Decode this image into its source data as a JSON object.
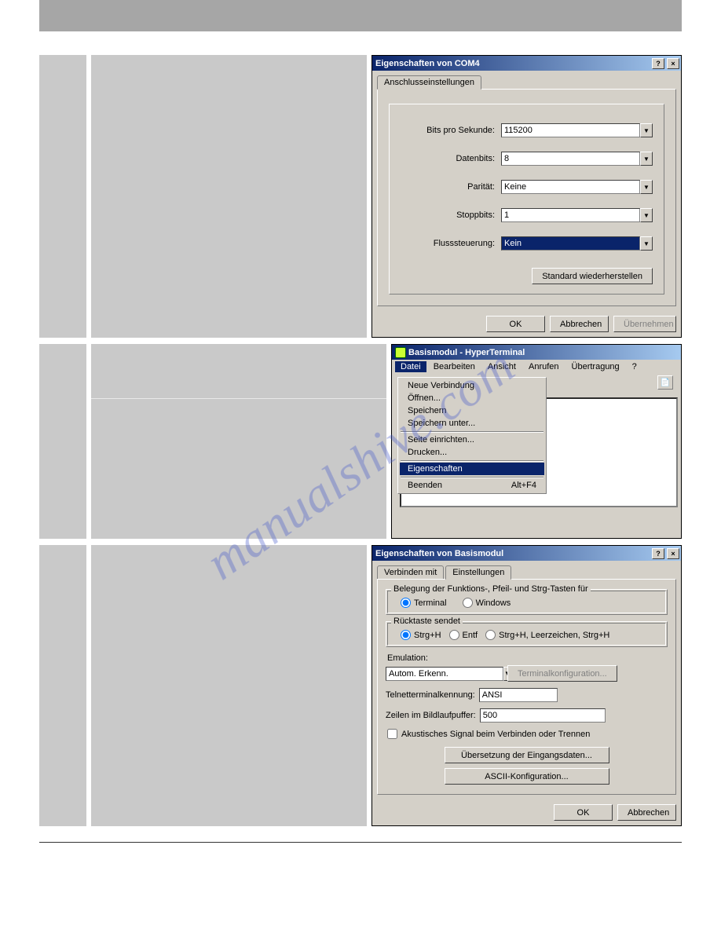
{
  "watermark": "manualshive.com",
  "dialog1": {
    "title": "Eigenschaften von COM4",
    "tab": "Anschlusseinstellungen",
    "fields": {
      "bps_label": "Bits pro Sekunde:",
      "bps_value": "115200",
      "databits_label": "Datenbits:",
      "databits_value": "8",
      "parity_label": "Parität:",
      "parity_value": "Keine",
      "stopbits_label": "Stoppbits:",
      "stopbits_value": "1",
      "flow_label": "Flusssteuerung:",
      "flow_value": "Kein"
    },
    "btn_restore": "Standard wiederherstellen",
    "btn_ok": "OK",
    "btn_cancel": "Abbrechen",
    "btn_apply": "Übernehmen"
  },
  "hyper": {
    "title": "Basismodul - HyperTerminal",
    "menu": {
      "datei": "Datei",
      "bearbeiten": "Bearbeiten",
      "ansicht": "Ansicht",
      "anrufen": "Anrufen",
      "uebertragung": "Übertragung",
      "help": "?"
    },
    "items": {
      "neu": "Neue Verbindung",
      "oeffnen": "Öffnen...",
      "speichern": "Speichern",
      "speichern_unter": "Speichern unter...",
      "seite": "Seite einrichten...",
      "drucken": "Drucken...",
      "eigenschaften": "Eigenschaften",
      "beenden": "Beenden",
      "beenden_key": "Alt+F4"
    }
  },
  "dialog2": {
    "title": "Eigenschaften von Basismodul",
    "tab1": "Verbinden mit",
    "tab2": "Einstellungen",
    "grp1": "Belegung der Funktions-, Pfeil- und Strg-Tasten für",
    "opt_terminal": "Terminal",
    "opt_windows": "Windows",
    "grp2": "Rücktaste sendet",
    "opt_strgh": "Strg+H",
    "opt_entf": "Entf",
    "opt_long": "Strg+H, Leerzeichen, Strg+H",
    "emulation_label": "Emulation:",
    "emulation_value": "Autom. Erkenn.",
    "btn_termconfig": "Terminalkonfiguration...",
    "telnet_label": "Telnetterminalkennung:",
    "telnet_value": "ANSI",
    "buffer_label": "Zeilen im Bildlaufpuffer:",
    "buffer_value": "500",
    "chk_sound": "Akustisches Signal beim Verbinden oder Trennen",
    "btn_translate": "Übersetzung der Eingangsdaten...",
    "btn_ascii": "ASCII-Konfiguration...",
    "btn_ok": "OK",
    "btn_cancel": "Abbrechen"
  }
}
